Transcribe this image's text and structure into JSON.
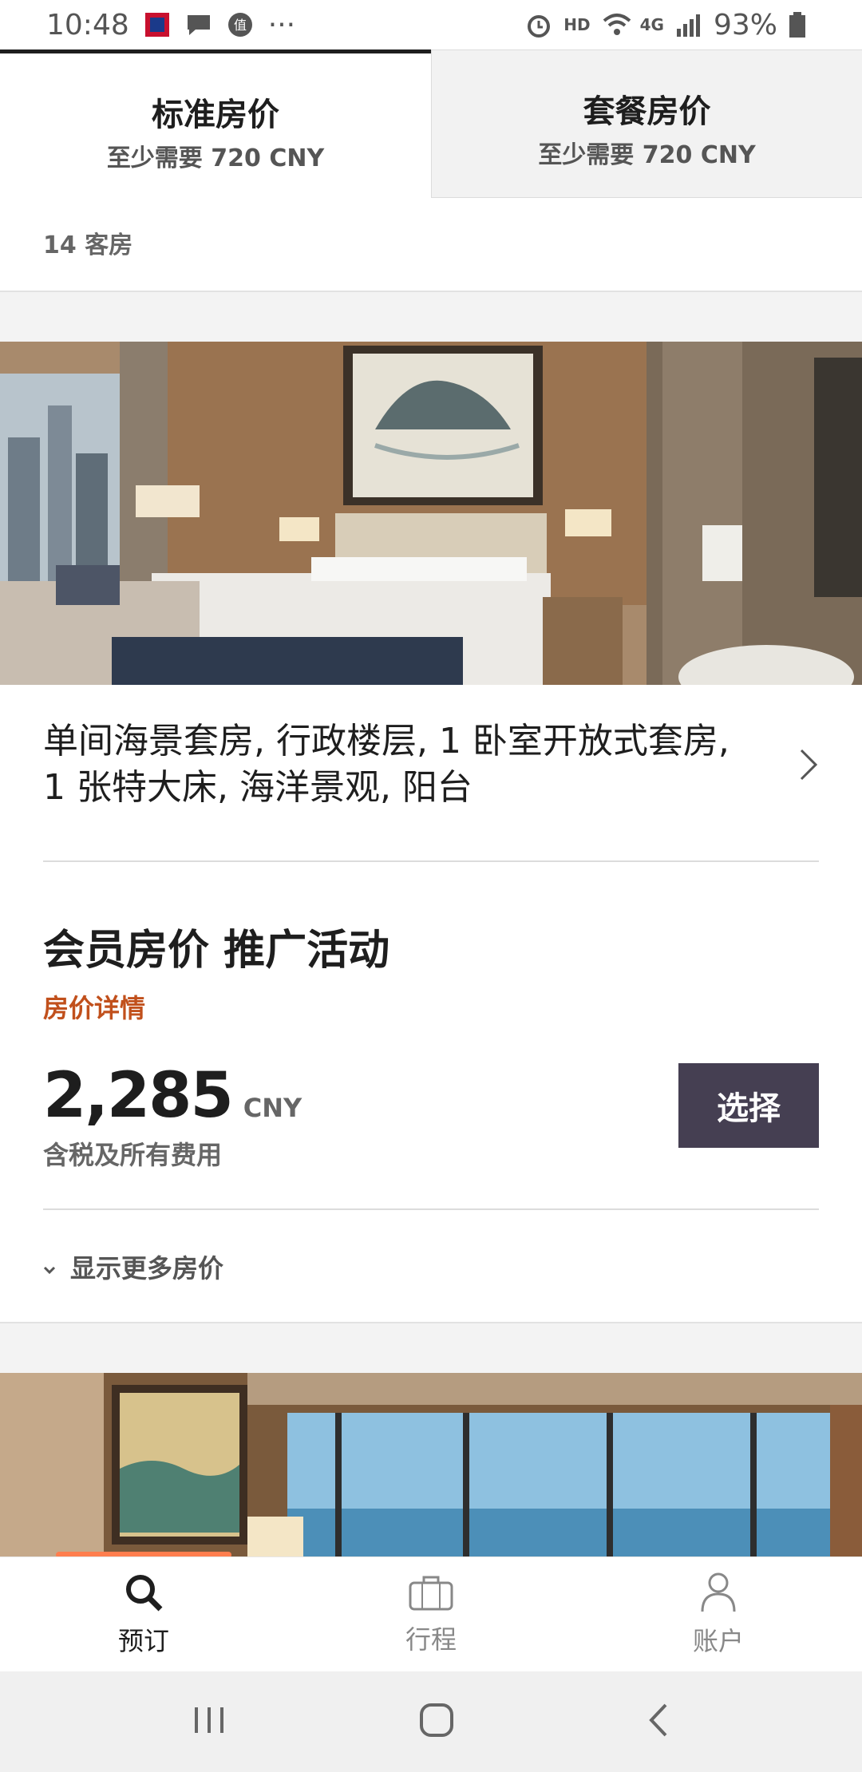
{
  "status_bar": {
    "time": "10:48",
    "battery": "93%",
    "network": "4G",
    "hd": "HD",
    "more": "···"
  },
  "tabs": [
    {
      "title": "标准房价",
      "subtitle": "至少需要 720 CNY",
      "active": true
    },
    {
      "title": "套餐房价",
      "subtitle": "至少需要 720 CNY",
      "active": false
    }
  ],
  "rooms_count": "14 客房",
  "room": {
    "title": "单间海景套房, 行政楼层, 1 卧室开放式套房, 1  张特大床, 海洋景观, 阳台"
  },
  "rate": {
    "title": "会员房价 推广活动",
    "details_link": "房价详情",
    "price": "2,285",
    "currency": "CNY",
    "note": "含税及所有费用",
    "select_label": "选择"
  },
  "more_rates": "显示更多房价",
  "bottom_nav": [
    {
      "label": "预订",
      "icon": "search-icon",
      "active": true
    },
    {
      "label": "行程",
      "icon": "briefcase-icon",
      "active": false
    },
    {
      "label": "账户",
      "icon": "person-icon",
      "active": false
    }
  ],
  "colors": {
    "accent": "#c1501c",
    "button": "#453f52",
    "indicator": "#ff7e4e"
  }
}
